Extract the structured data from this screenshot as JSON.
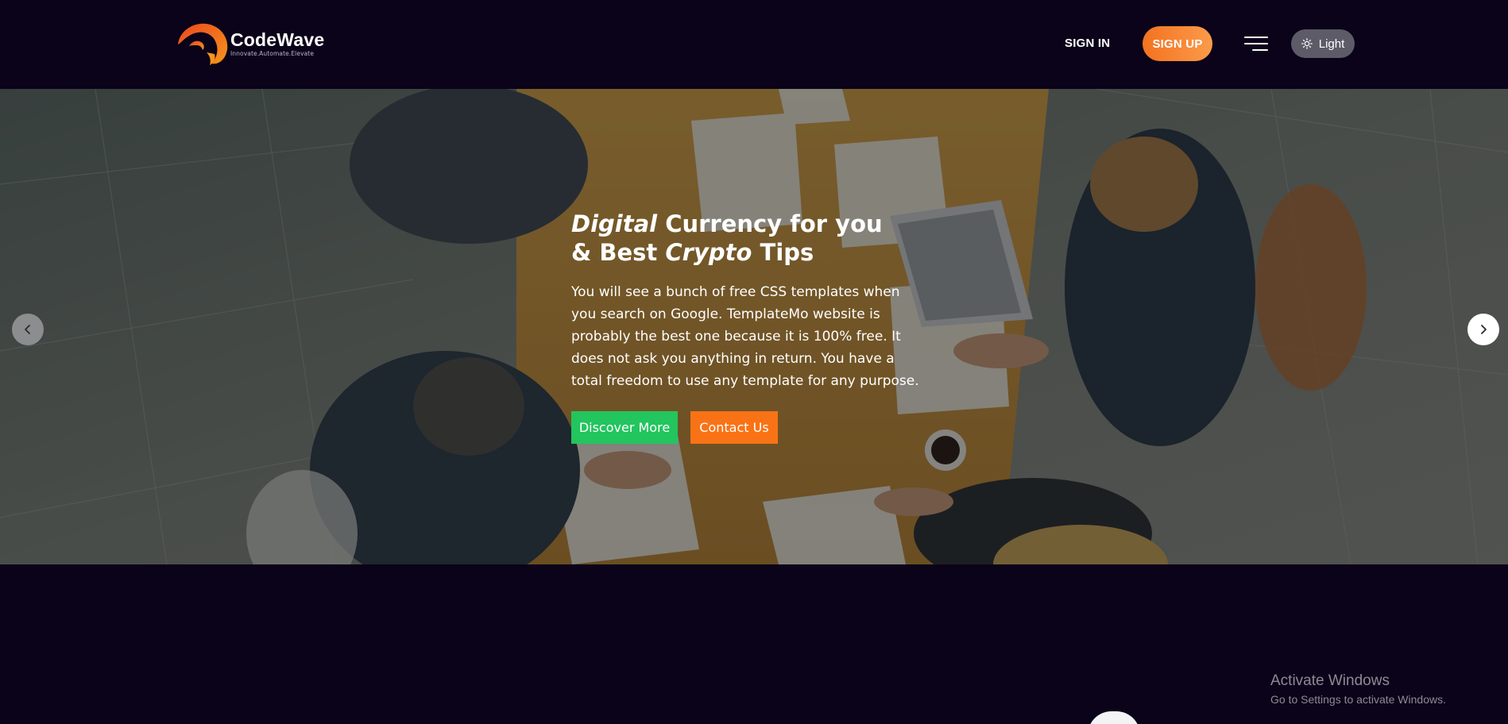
{
  "header": {
    "brand": {
      "name": "CodeWave",
      "tagline": "Innovate.Automate.Elevate",
      "logo_icon": "wave-swirl-logo"
    },
    "nav": {
      "signin_label": "SIGN IN",
      "signup_label": "SIGN UP",
      "menu_icon": "hamburger-menu-icon",
      "theme_toggle_label": "Light",
      "theme_icon": "sun-icon"
    }
  },
  "hero": {
    "title": {
      "line1_italic": "Digital",
      "line1_rest": " Currency for you",
      "line2_start": "& Best ",
      "line2_italic": "Crypto",
      "line2_end": " Tips"
    },
    "description": "You will see a bunch of free CSS templates when you search on Google. TemplateMo website is probably the best one because it is 100% free. It does not ask you anything in return. You have a total freedom to use any template for any purpose.",
    "buttons": {
      "discover_label": "Discover More",
      "contact_label": "Contact Us"
    },
    "carousel": {
      "prev_icon": "chevron-left-icon",
      "next_icon": "chevron-right-icon"
    }
  },
  "watermark": {
    "title": "Activate Windows",
    "subtitle": "Go to Settings to activate Windows."
  },
  "colors": {
    "background": "#0b0319",
    "accent_orange": "#f97316",
    "accent_green": "#22c55e",
    "toggle_bg": "#5e5b69"
  }
}
